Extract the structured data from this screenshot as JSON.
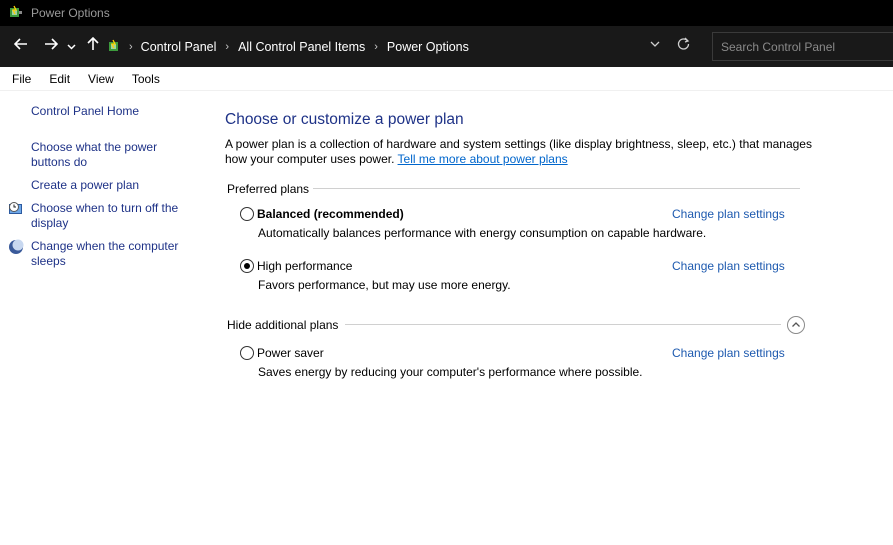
{
  "window": {
    "title": "Power Options",
    "icon": "power-options-icon"
  },
  "nav": {
    "back_icon": "arrow-left-icon",
    "forward_icon": "arrow-right-icon",
    "recent_icon": "chevron-down-icon",
    "up_icon": "arrow-up-icon"
  },
  "address": {
    "crumbs": [
      "Control Panel",
      "All Control Panel Items",
      "Power Options"
    ],
    "separator": "›",
    "dropdown_icon": "chevron-down-icon",
    "refresh_icon": "refresh-icon"
  },
  "search": {
    "placeholder": "Search Control Panel"
  },
  "menu": {
    "items": [
      "File",
      "Edit",
      "View",
      "Tools"
    ]
  },
  "sidebar": {
    "items": [
      {
        "label": "Control Panel Home",
        "icon": ""
      },
      {
        "label": "Choose what the power buttons do",
        "icon": ""
      },
      {
        "label": "Create a power plan",
        "icon": ""
      },
      {
        "label": "Choose when to turn off the display",
        "icon": "clock-monitor-icon"
      },
      {
        "label": "Change when the computer sleeps",
        "icon": "moon-sleep-icon"
      }
    ]
  },
  "main": {
    "title": "Choose or customize a power plan",
    "description": "A power plan is a collection of hardware and system settings (like display brightness, sleep, etc.) that manages how your computer uses power.",
    "description_link": "Tell me more about power plans",
    "preferred_label": "Preferred plans",
    "hide_label": "Hide additional plans",
    "plans": [
      {
        "name": "Balanced (recommended)",
        "desc": "Automatically balances performance with energy consumption on capable hardware.",
        "link": "Change plan settings",
        "selected": false
      },
      {
        "name": "High performance",
        "desc": "Favors performance, but may use more energy.",
        "link": "Change plan settings",
        "selected": true
      },
      {
        "name": "Power saver",
        "desc": "Saves energy by reducing your computer's performance where possible.",
        "link": "Change plan settings",
        "selected": false
      }
    ]
  },
  "colors": {
    "accent": "#1e3287",
    "link": "#0066cc",
    "titlebar": "#000000",
    "toolbar": "#191919"
  }
}
